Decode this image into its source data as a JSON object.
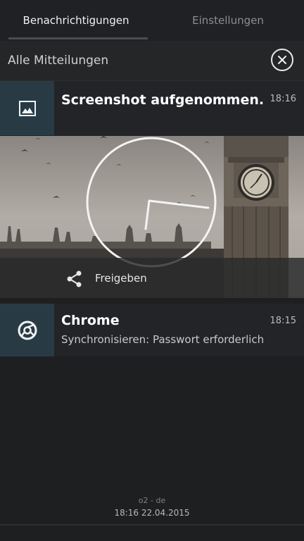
{
  "tabs": [
    {
      "label": "Benachrichtigungen",
      "active": true
    },
    {
      "label": "Einstellungen",
      "active": false
    }
  ],
  "header": {
    "title": "Alle Mitteilungen",
    "clear_icon": "close-circle-icon"
  },
  "notifications": [
    {
      "icon": "image-icon",
      "title": "Screenshot aufgenommen.",
      "time": "18:16",
      "action_label": "Freigeben",
      "action_icon": "share-icon"
    },
    {
      "icon": "chrome-icon",
      "title": "Chrome",
      "time": "18:15",
      "text": "Synchronisieren: Passwort erforderlich"
    }
  ],
  "footer": {
    "operator": "o2 - de",
    "datetime": "18:16  22.04.2015"
  },
  "colors": {
    "icon_box": "#283b45",
    "card_bg": "#232427",
    "background": "#1e1f21"
  }
}
